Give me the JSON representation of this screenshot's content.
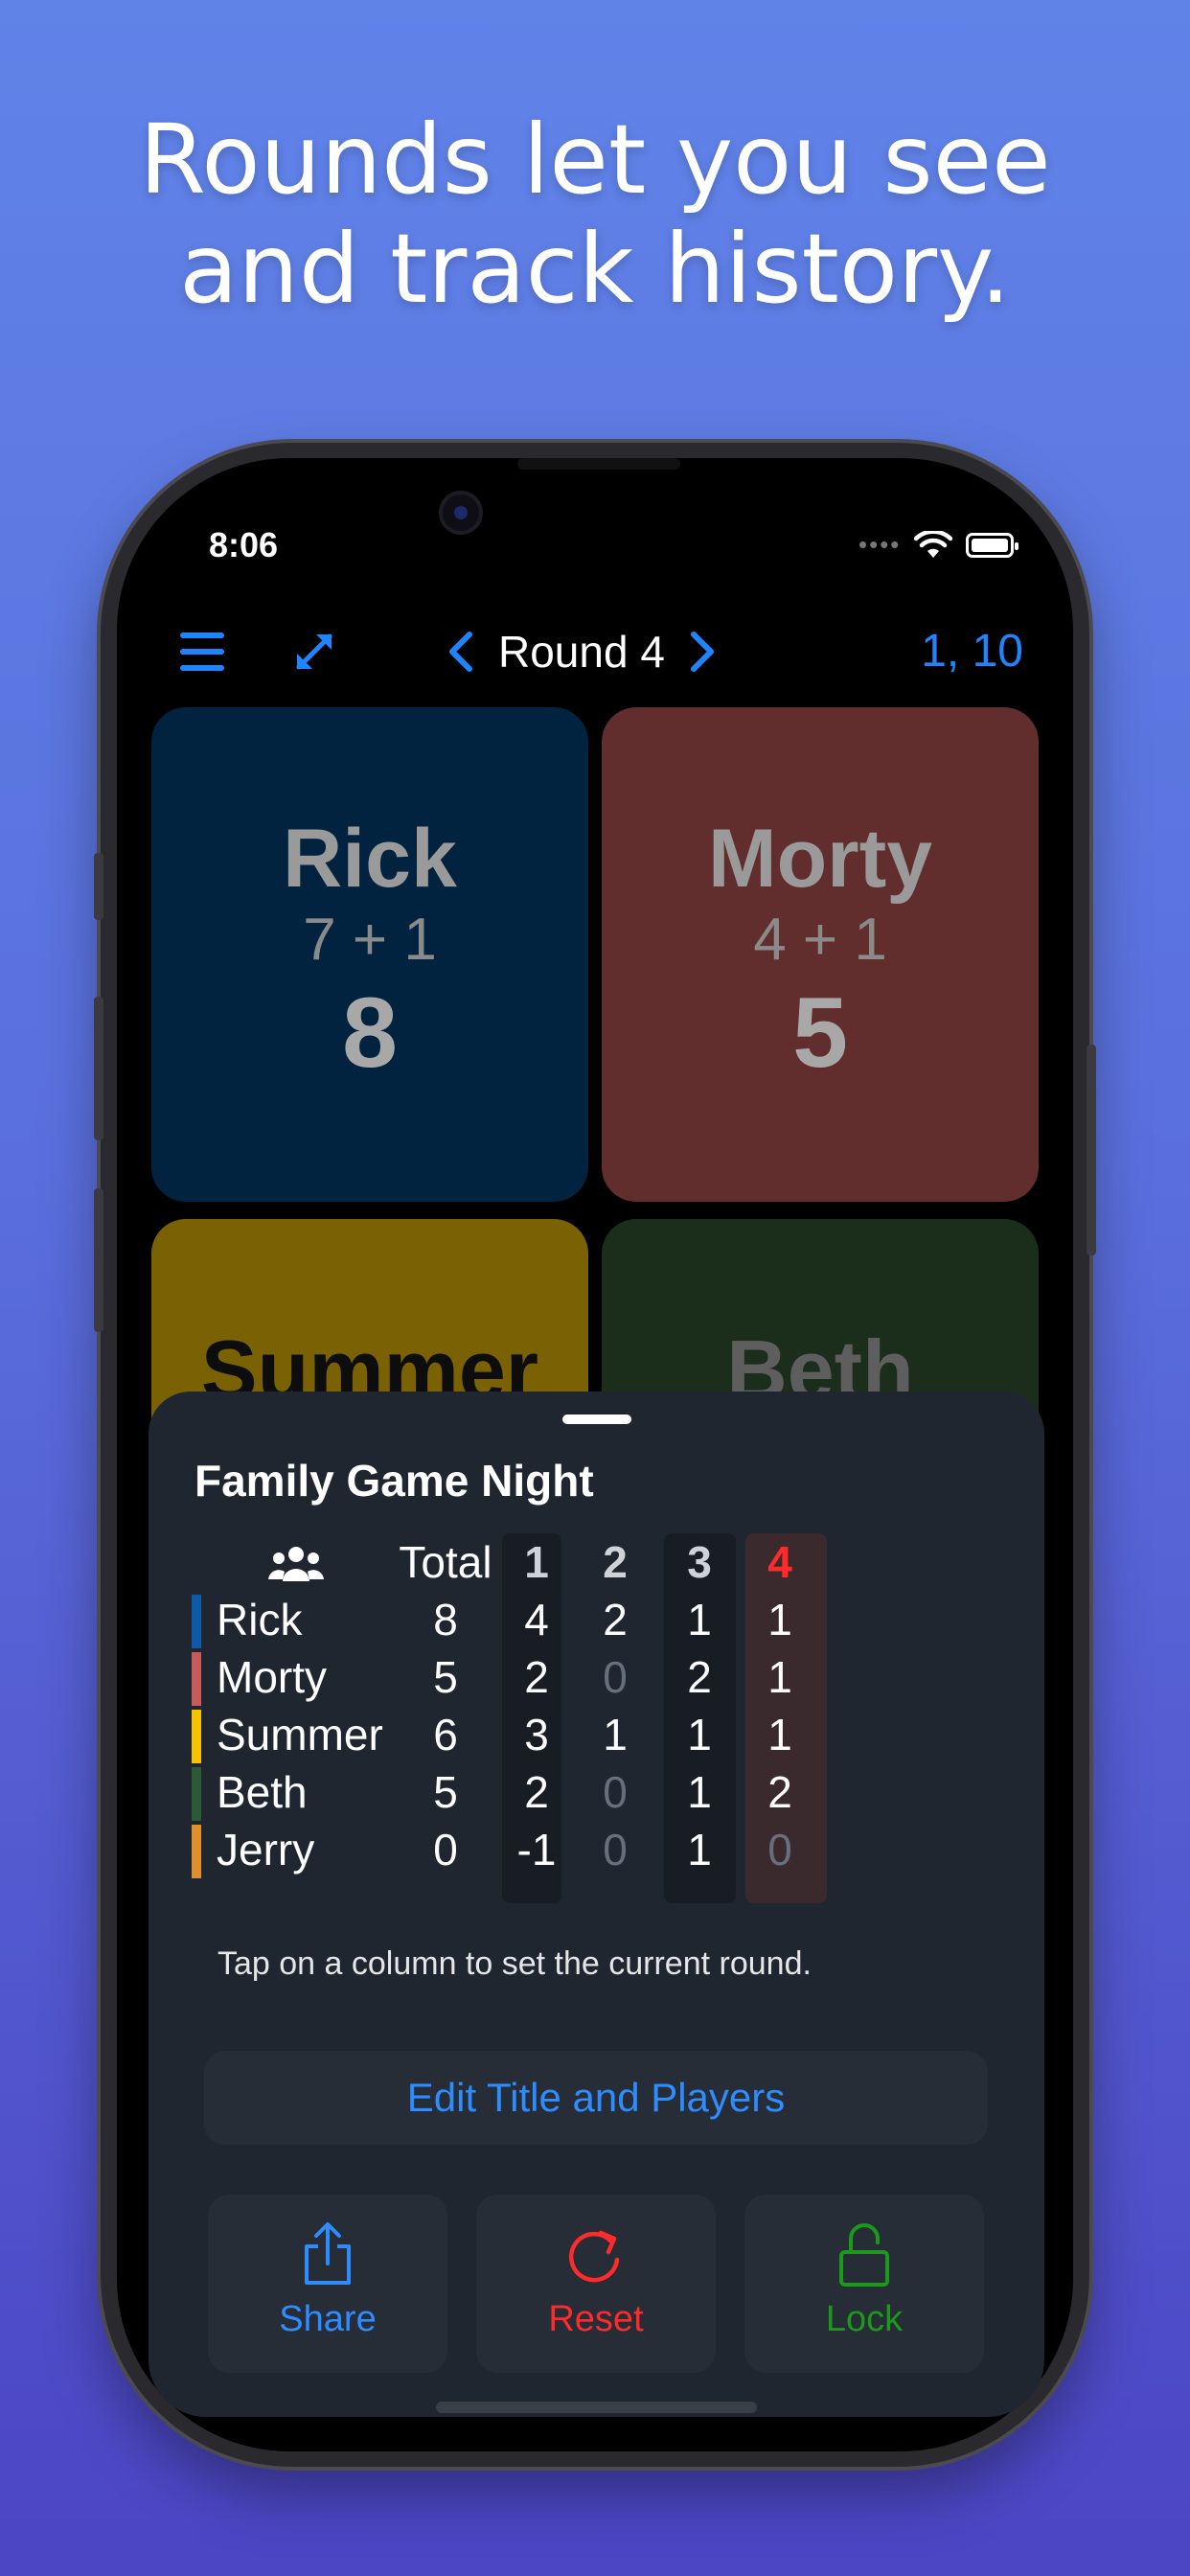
{
  "headline": {
    "line1": "Rounds let you see",
    "line2": "and track history."
  },
  "status_bar": {
    "time": "8:06"
  },
  "nav": {
    "round_title": "Round 4",
    "score_ref": "1, 10"
  },
  "tiles": [
    {
      "name": "Rick",
      "calc": "7 + 1",
      "total": "8",
      "color": "#012340"
    },
    {
      "name": "Morty",
      "calc": "4 + 1",
      "total": "5",
      "color": "#612d2d"
    },
    {
      "name": "Summer",
      "color": "#7a6104"
    },
    {
      "name": "Beth",
      "color": "#1b2d1b"
    }
  ],
  "sheet": {
    "title": "Family Game Night",
    "table": {
      "total_header": "Total",
      "round_headers": [
        "1",
        "2",
        "3",
        "4"
      ],
      "current_round": "4",
      "rows": [
        {
          "name": "Rick",
          "color": "#0e5aa6",
          "total": "8",
          "rounds": [
            "4",
            "2",
            "1",
            "1"
          ]
        },
        {
          "name": "Morty",
          "color": "#c75b5b",
          "total": "5",
          "rounds": [
            "2",
            "0",
            "2",
            "1"
          ]
        },
        {
          "name": "Summer",
          "color": "#f5c400",
          "total": "6",
          "rounds": [
            "3",
            "1",
            "1",
            "1"
          ]
        },
        {
          "name": "Beth",
          "color": "#2c5a37",
          "total": "5",
          "rounds": [
            "2",
            "0",
            "1",
            "2"
          ]
        },
        {
          "name": "Jerry",
          "color": "#e0902a",
          "total": "0",
          "rounds": [
            "-1",
            "0",
            "1",
            "0"
          ]
        }
      ]
    },
    "hint": "Tap on a column to set the current round.",
    "edit_button": "Edit Title and Players",
    "actions": {
      "share": "Share",
      "reset": "Reset",
      "lock": "Lock"
    }
  },
  "colors": {
    "accent_blue": "#2d8cff",
    "reset_red": "#ff2a2a",
    "lock_green": "#1a9a1a",
    "current_round_red": "#ff2a2a"
  },
  "icons": [
    "menu-icon",
    "expand-icon",
    "chevron-left-icon",
    "chevron-right-icon",
    "wifi-icon",
    "battery-icon",
    "players-icon",
    "share-icon",
    "reset-icon",
    "lock-icon"
  ]
}
